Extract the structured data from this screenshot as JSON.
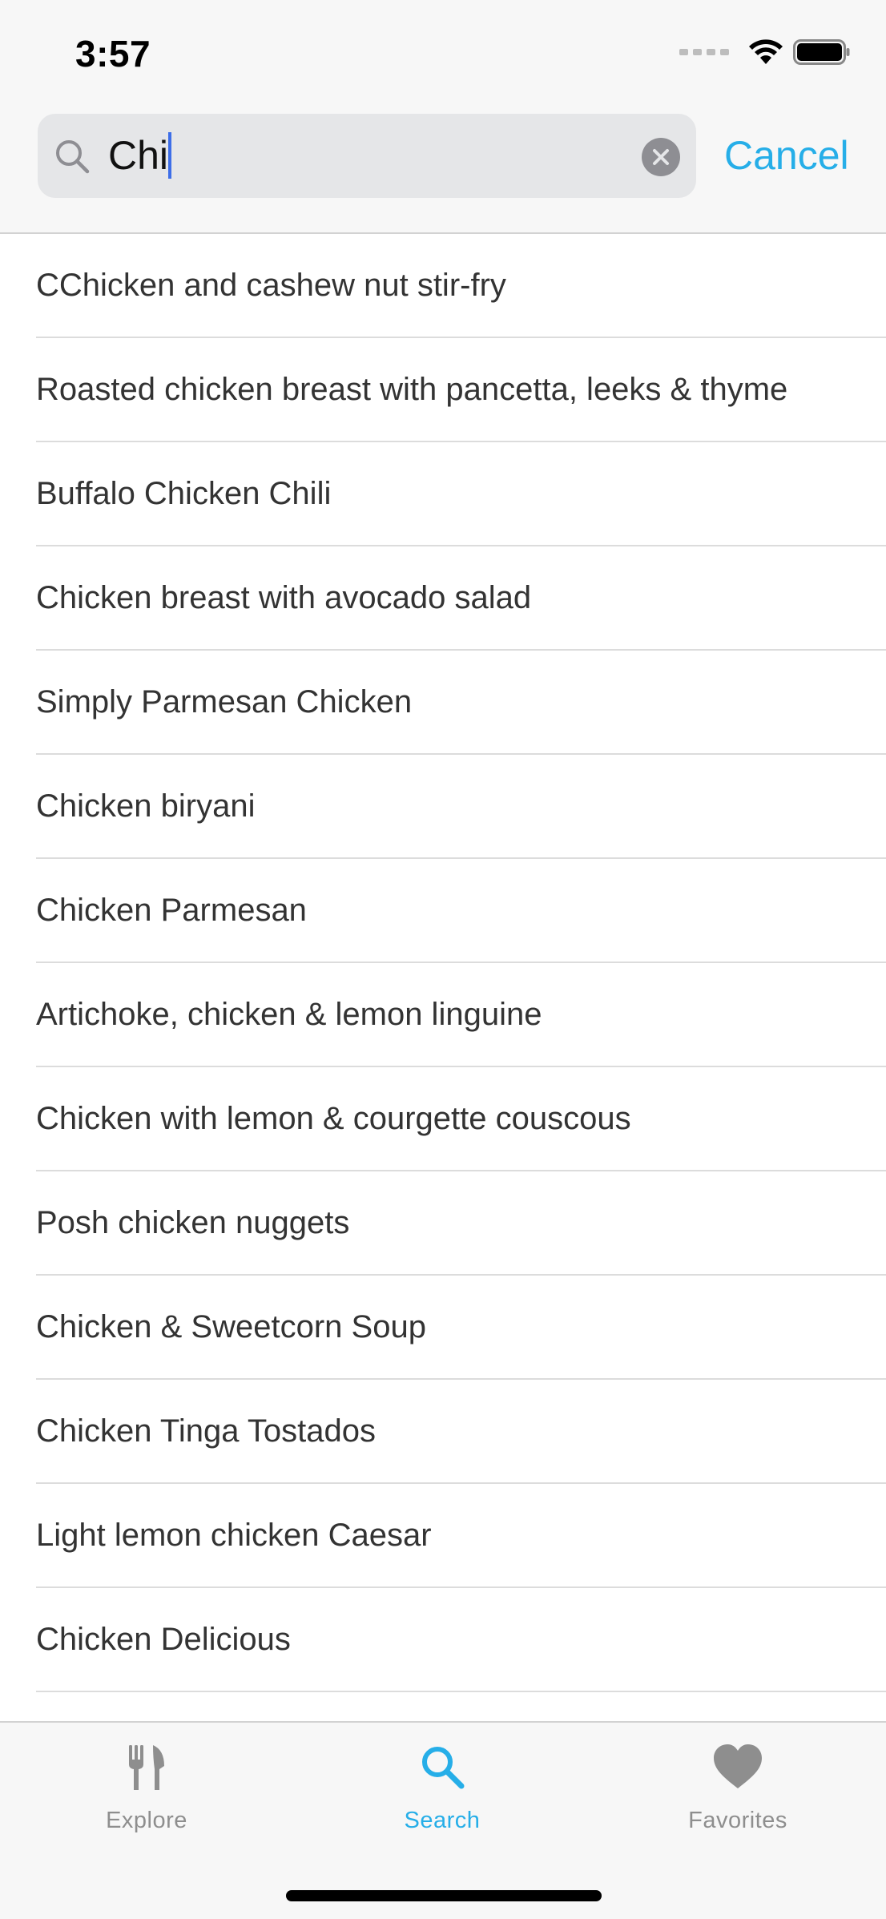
{
  "status_bar": {
    "time": "3:57"
  },
  "search": {
    "query": "Chi",
    "cancel_label": "Cancel"
  },
  "results": [
    {
      "label": "CChicken and cashew nut stir-fry"
    },
    {
      "label": "Roasted chicken breast with pancetta, leeks & thyme"
    },
    {
      "label": "Buffalo Chicken Chili"
    },
    {
      "label": "Chicken breast with avocado salad"
    },
    {
      "label": "Simply Parmesan Chicken"
    },
    {
      "label": "Chicken biryani"
    },
    {
      "label": "Chicken Parmesan"
    },
    {
      "label": "Artichoke, chicken & lemon linguine"
    },
    {
      "label": "Chicken with lemon & courgette couscous"
    },
    {
      "label": "Posh chicken nuggets"
    },
    {
      "label": "Chicken & Sweetcorn Soup"
    },
    {
      "label": "Chicken Tinga Tostados"
    },
    {
      "label": "Light lemon chicken Caesar"
    },
    {
      "label": "Chicken Delicious"
    }
  ],
  "tab_bar": {
    "tabs": [
      {
        "label": "Explore",
        "icon": "fork-knife-icon",
        "active": false
      },
      {
        "label": "Search",
        "icon": "search-icon",
        "active": true
      },
      {
        "label": "Favorites",
        "icon": "heart-icon",
        "active": false
      }
    ]
  },
  "colors": {
    "accent": "#26aee8",
    "inactive": "#8e8e8e",
    "text": "#333333"
  }
}
